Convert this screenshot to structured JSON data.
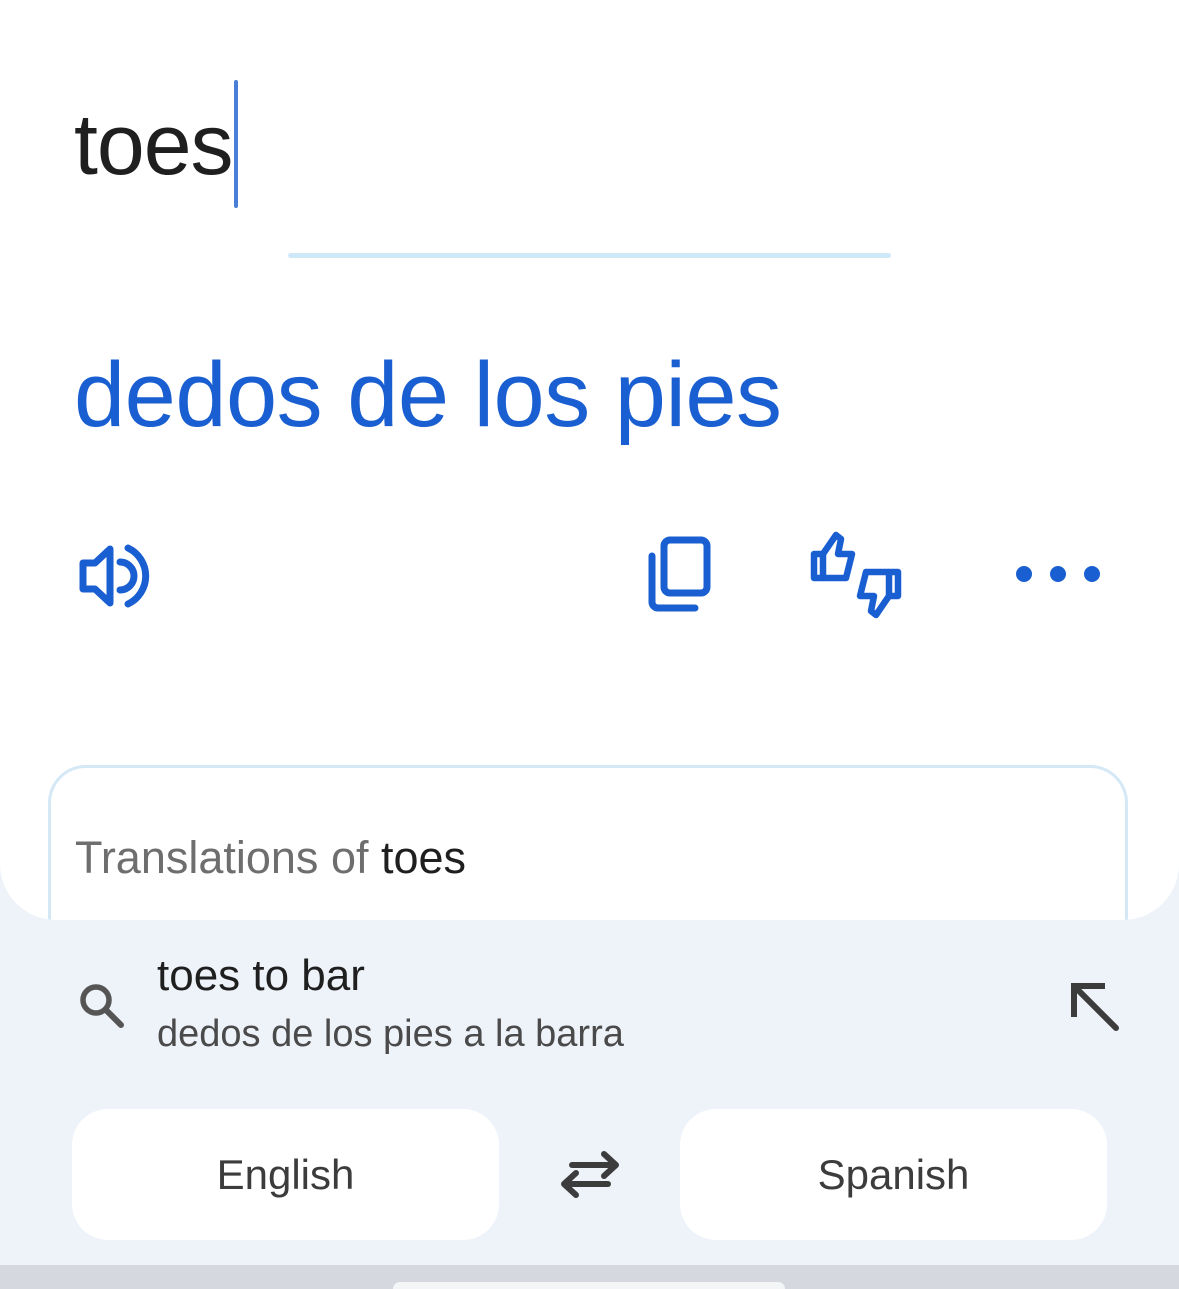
{
  "input": {
    "text": "toes"
  },
  "translation": {
    "text": "dedos de los pies"
  },
  "actions": {
    "listen_icon": "speaker-icon",
    "copy_icon": "copy-icon",
    "rate_icon": "thumbs-up-down-icon",
    "more_icon": "more-horizontal-icon"
  },
  "translations_panel": {
    "prefix": "Translations of ",
    "word": "toes"
  },
  "suggestion": {
    "icon": "search-icon",
    "primary": "toes to bar",
    "secondary": "dedos de los pies a la barra",
    "fill_icon": "arrow-up-left-icon"
  },
  "languages": {
    "source": "English",
    "target": "Spanish",
    "swap_icon": "swap-arrows-icon"
  },
  "colors": {
    "accent": "#1a5fd1",
    "caret": "#4a7fd8",
    "background": "#eef3fa",
    "divider": "#cfe8f8"
  }
}
